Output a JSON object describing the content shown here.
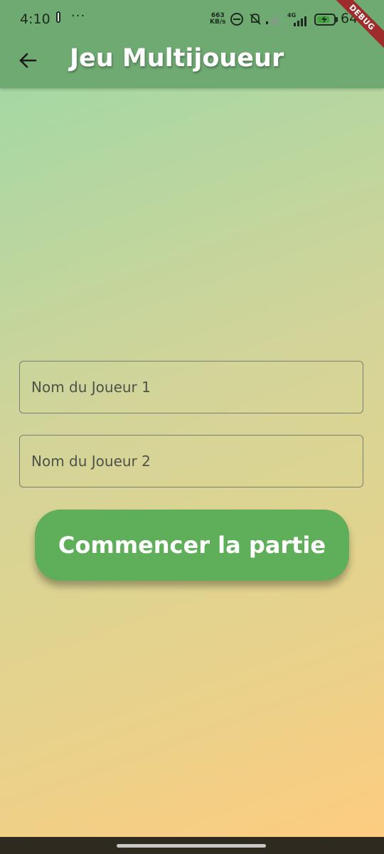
{
  "status_bar": {
    "time": "4:10",
    "dots": "···",
    "net_speed_value": "663",
    "net_speed_unit": "KB/s",
    "network_type": "4G",
    "battery": "64"
  },
  "app_bar": {
    "title": "Jeu Multijoueur",
    "debug_banner": "DEBUG"
  },
  "form": {
    "player1_placeholder": "Nom du Joueur 1",
    "player1_value": "",
    "player2_placeholder": "Nom du Joueur 2",
    "player2_value": "",
    "start_button_label": "Commencer la partie"
  },
  "colors": {
    "app_bar": "#6faa72",
    "button": "#5fae59",
    "gradient_start": "#a5d8a4",
    "gradient_end": "#fdcc80",
    "debug_banner": "#9d2c2a"
  }
}
